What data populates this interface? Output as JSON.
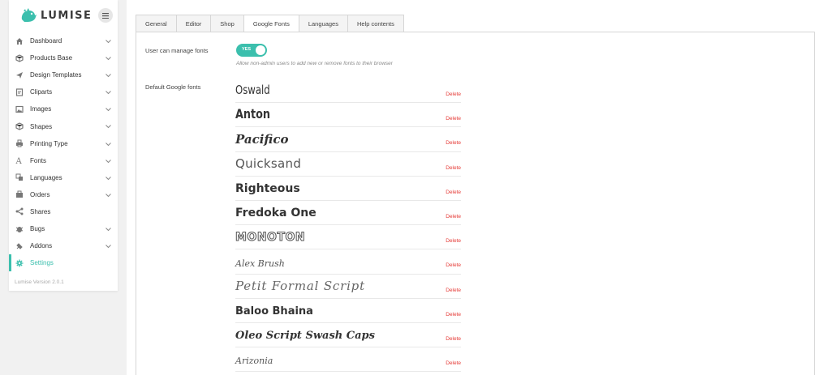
{
  "brand": {
    "name": "LUMISE",
    "accent": "#3bbfad"
  },
  "sidebar": {
    "items": [
      {
        "label": "Dashboard",
        "icon": "home-icon",
        "has_children": true
      },
      {
        "label": "Products Base",
        "icon": "cube-icon",
        "has_children": true
      },
      {
        "label": "Design Templates",
        "icon": "paper-plane-icon",
        "has_children": true
      },
      {
        "label": "Cliparts",
        "icon": "clipart-icon",
        "has_children": true
      },
      {
        "label": "Images",
        "icon": "image-icon",
        "has_children": true
      },
      {
        "label": "Shapes",
        "icon": "cube-icon",
        "has_children": true
      },
      {
        "label": "Printing Type",
        "icon": "printer-icon",
        "has_children": true
      },
      {
        "label": "Fonts",
        "icon": "font-icon",
        "has_children": true
      },
      {
        "label": "Languages",
        "icon": "translate-icon",
        "has_children": true
      },
      {
        "label": "Orders",
        "icon": "orders-icon",
        "has_children": true
      },
      {
        "label": "Shares",
        "icon": "share-icon",
        "has_children": false
      },
      {
        "label": "Bugs",
        "icon": "bug-icon",
        "has_children": true
      },
      {
        "label": "Addons",
        "icon": "plug-icon",
        "has_children": true
      },
      {
        "label": "Settings",
        "icon": "gear-icon",
        "has_children": false,
        "active": true
      }
    ],
    "version": "Lumise Version 2.0.1"
  },
  "tabs": [
    "General",
    "Editor",
    "Shop",
    "Google Fonts",
    "Languages",
    "Help contents"
  ],
  "active_tab": "Google Fonts",
  "settings": {
    "manage_fonts_label": "User can manage fonts",
    "toggle_text": "YES",
    "manage_fonts_hint": "Allow non-admin users to add new or remove fonts to their browser",
    "default_fonts_label": "Default Google fonts",
    "delete_label": "Delete",
    "fonts": [
      "Oswald",
      "Anton",
      "Pacifico",
      "Quicksand",
      "Righteous",
      "Fredoka One",
      "Monoton",
      "Alex Brush",
      "Petit Formal Script",
      "Baloo Bhaina",
      "Oleo Script Swash Caps",
      "Arizonia"
    ]
  }
}
